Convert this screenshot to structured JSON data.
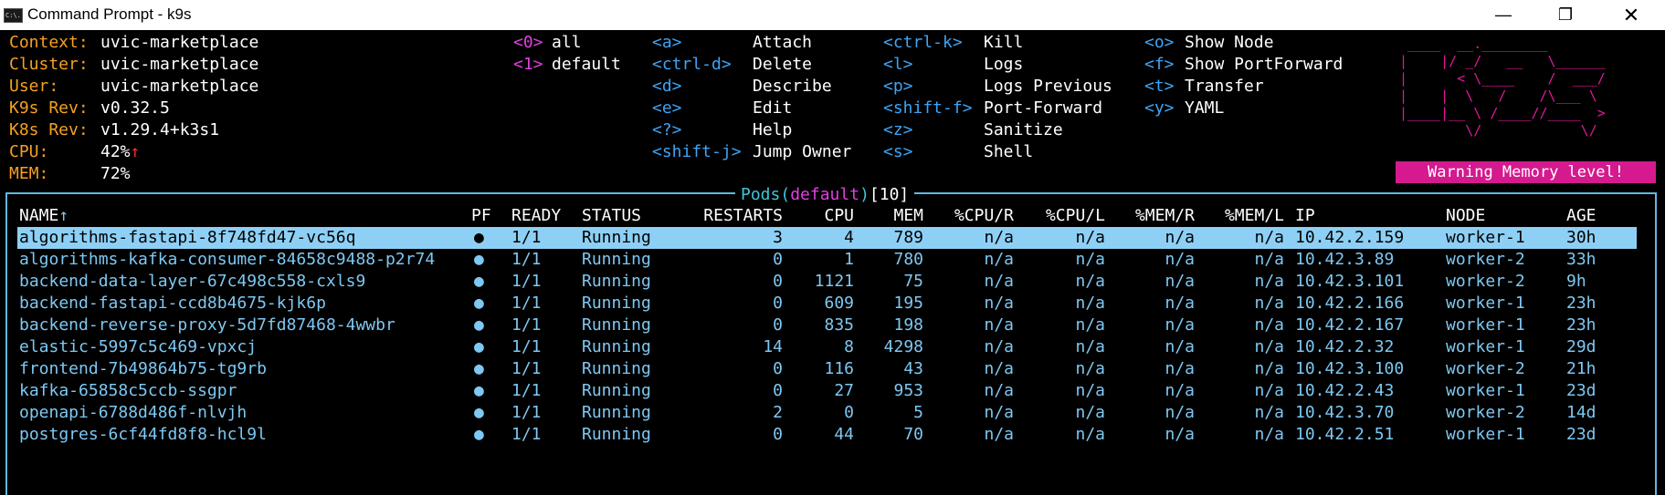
{
  "window": {
    "icon": "C:\\.",
    "title": "Command Prompt - k9s",
    "minimize": "—",
    "maximize": "❐",
    "close": "✕"
  },
  "info": {
    "context_label": "Context:",
    "context": "uvic-marketplace",
    "cluster_label": "Cluster:",
    "cluster": "uvic-marketplace",
    "user_label": "User:",
    "user": "uvic-marketplace",
    "k9s_rev_label": "K9s Rev:",
    "k9s_rev": "v0.32.5",
    "k8s_rev_label": "K8s Rev:",
    "k8s_rev": "v1.29.4+k3s1",
    "cpu_label": "CPU:",
    "cpu": "42%",
    "cpu_trend": "↑",
    "mem_label": "MEM:",
    "mem": "72%"
  },
  "namespaces": [
    {
      "key": "<0>",
      "label": "all"
    },
    {
      "key": "<1>",
      "label": "default"
    }
  ],
  "shortcuts_col1": [
    {
      "key": "<a>",
      "label": "Attach"
    },
    {
      "key": "<ctrl-d>",
      "label": "Delete"
    },
    {
      "key": "<d>",
      "label": "Describe"
    },
    {
      "key": "<e>",
      "label": "Edit"
    },
    {
      "key": "<?>",
      "label": "Help"
    },
    {
      "key": "<shift-j>",
      "label": "Jump Owner"
    }
  ],
  "shortcuts_col2": [
    {
      "key": "<ctrl-k>",
      "label": "Kill"
    },
    {
      "key": "<l>",
      "label": "Logs"
    },
    {
      "key": "<p>",
      "label": "Logs Previous"
    },
    {
      "key": "<shift-f>",
      "label": "Port-Forward"
    },
    {
      "key": "<z>",
      "label": "Sanitize"
    },
    {
      "key": "<s>",
      "label": "Shell"
    }
  ],
  "shortcuts_col3": [
    {
      "key": "<o>",
      "label": "Show Node"
    },
    {
      "key": "<f>",
      "label": "Show PortForward"
    },
    {
      "key": "<t>",
      "label": "Transfer"
    },
    {
      "key": "<y>",
      "label": "YAML"
    }
  ],
  "logo_ascii": " ____  __.________\n|    |/ _/   __   \\______\n|      < \\____    /  ___/\n|    |  \\   /    /\\___ \\\n|____|__ \\ /____//____  >\n        \\/            \\/",
  "warning": "Warning Memory level!",
  "panel": {
    "resource": "Pods",
    "open": "(",
    "namespace": "default",
    "close": ")",
    "count": "[10]"
  },
  "columns": {
    "name": "NAME",
    "sort_indicator": "↑",
    "pf": "PF",
    "ready": "READY",
    "status": "STATUS",
    "restarts": "RESTARTS",
    "cpu": "CPU",
    "mem": "MEM",
    "cpu_r": "%CPU/R",
    "cpu_l": "%CPU/L",
    "mem_r": "%MEM/R",
    "mem_l": "%MEM/L",
    "ip": "IP",
    "node": "NODE",
    "age": "AGE"
  },
  "pods": [
    {
      "name": "algorithms-fastapi-8f748fd47-vc56q",
      "pf": "●",
      "ready": "1/1",
      "status": "Running",
      "restarts": "3",
      "cpu": "4",
      "mem": "789",
      "cpu_r": "n/a",
      "cpu_l": "n/a",
      "mem_r": "n/a",
      "mem_l": "n/a",
      "ip": "10.42.2.159",
      "node": "worker-1",
      "age": "30h"
    },
    {
      "name": "algorithms-kafka-consumer-84658c9488-p2r74",
      "pf": "●",
      "ready": "1/1",
      "status": "Running",
      "restarts": "0",
      "cpu": "1",
      "mem": "780",
      "cpu_r": "n/a",
      "cpu_l": "n/a",
      "mem_r": "n/a",
      "mem_l": "n/a",
      "ip": "10.42.3.89",
      "node": "worker-2",
      "age": "33h"
    },
    {
      "name": "backend-data-layer-67c498c558-cxls9",
      "pf": "●",
      "ready": "1/1",
      "status": "Running",
      "restarts": "0",
      "cpu": "1121",
      "mem": "75",
      "cpu_r": "n/a",
      "cpu_l": "n/a",
      "mem_r": "n/a",
      "mem_l": "n/a",
      "ip": "10.42.3.101",
      "node": "worker-2",
      "age": "9h"
    },
    {
      "name": "backend-fastapi-ccd8b4675-kjk6p",
      "pf": "●",
      "ready": "1/1",
      "status": "Running",
      "restarts": "0",
      "cpu": "609",
      "mem": "195",
      "cpu_r": "n/a",
      "cpu_l": "n/a",
      "mem_r": "n/a",
      "mem_l": "n/a",
      "ip": "10.42.2.166",
      "node": "worker-1",
      "age": "23h"
    },
    {
      "name": "backend-reverse-proxy-5d7fd87468-4wwbr",
      "pf": "●",
      "ready": "1/1",
      "status": "Running",
      "restarts": "0",
      "cpu": "835",
      "mem": "198",
      "cpu_r": "n/a",
      "cpu_l": "n/a",
      "mem_r": "n/a",
      "mem_l": "n/a",
      "ip": "10.42.2.167",
      "node": "worker-1",
      "age": "23h"
    },
    {
      "name": "elastic-5997c5c469-vpxcj",
      "pf": "●",
      "ready": "1/1",
      "status": "Running",
      "restarts": "14",
      "cpu": "8",
      "mem": "4298",
      "cpu_r": "n/a",
      "cpu_l": "n/a",
      "mem_r": "n/a",
      "mem_l": "n/a",
      "ip": "10.42.2.32",
      "node": "worker-1",
      "age": "29d"
    },
    {
      "name": "frontend-7b49864b75-tg9rb",
      "pf": "●",
      "ready": "1/1",
      "status": "Running",
      "restarts": "0",
      "cpu": "116",
      "mem": "43",
      "cpu_r": "n/a",
      "cpu_l": "n/a",
      "mem_r": "n/a",
      "mem_l": "n/a",
      "ip": "10.42.3.100",
      "node": "worker-2",
      "age": "21h"
    },
    {
      "name": "kafka-65858c5ccb-ssgpr",
      "pf": "●",
      "ready": "1/1",
      "status": "Running",
      "restarts": "0",
      "cpu": "27",
      "mem": "953",
      "cpu_r": "n/a",
      "cpu_l": "n/a",
      "mem_r": "n/a",
      "mem_l": "n/a",
      "ip": "10.42.2.43",
      "node": "worker-1",
      "age": "23d"
    },
    {
      "name": "openapi-6788d486f-nlvjh",
      "pf": "●",
      "ready": "1/1",
      "status": "Running",
      "restarts": "2",
      "cpu": "0",
      "mem": "5",
      "cpu_r": "n/a",
      "cpu_l": "n/a",
      "mem_r": "n/a",
      "mem_l": "n/a",
      "ip": "10.42.3.70",
      "node": "worker-2",
      "age": "14d"
    },
    {
      "name": "postgres-6cf44fd8f8-hcl9l",
      "pf": "●",
      "ready": "1/1",
      "status": "Running",
      "restarts": "0",
      "cpu": "44",
      "mem": "70",
      "cpu_r": "n/a",
      "cpu_l": "n/a",
      "mem_r": "n/a",
      "mem_l": "n/a",
      "ip": "10.42.2.51",
      "node": "worker-1",
      "age": "23d"
    }
  ],
  "selected_index": 0,
  "colors": {
    "selection": "#8ed0f5",
    "warning_bg": "#d41a8e",
    "logo": "#e0189a",
    "label": "#f6a022",
    "key": "#3ea4f5",
    "ns_key": "#e23fe2",
    "border": "#62b8e0"
  }
}
